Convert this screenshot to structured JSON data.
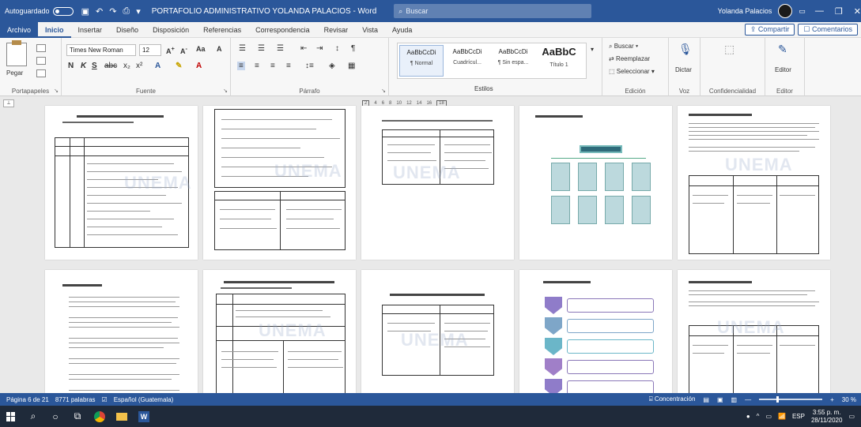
{
  "titlebar": {
    "autosave_label": "Autoguardado",
    "document_title": "PORTAFOLIO ADMINISTRATIVO YOLANDA PALACIOS - Word",
    "search_placeholder": "Buscar",
    "user_name": "Yolanda Palacios"
  },
  "tabs": [
    {
      "label": "Archivo"
    },
    {
      "label": "Inicio"
    },
    {
      "label": "Insertar"
    },
    {
      "label": "Diseño"
    },
    {
      "label": "Disposición"
    },
    {
      "label": "Referencias"
    },
    {
      "label": "Correspondencia"
    },
    {
      "label": "Revisar"
    },
    {
      "label": "Vista"
    },
    {
      "label": "Ayuda"
    }
  ],
  "share_label": "Compartir",
  "comments_label": "Comentarios",
  "ribbon": {
    "paste_label": "Pegar",
    "clipboard_label": "Portapapeles",
    "font_name": "Times New Roman",
    "font_size": "12",
    "font_group_label": "Fuente",
    "paragraph_label": "Párrafo",
    "styles": [
      {
        "sample": "AaBbCcDi",
        "name": "¶ Normal"
      },
      {
        "sample": "AaBbCcDi",
        "name": "Cuadrícul..."
      },
      {
        "sample": "AaBbCcDi",
        "name": "¶ Sin espa..."
      },
      {
        "sample": "AaBbC",
        "name": "Título 1"
      }
    ],
    "styles_label": "Estilos",
    "find_label": "Buscar",
    "replace_label": "Reemplazar",
    "select_label": "Seleccionar",
    "editing_label": "Edición",
    "dictate_label": "Dictar",
    "voice_label": "Voz",
    "sensitivity_label": "Confidencialidad",
    "editor_label": "Editor"
  },
  "pager": [
    "2",
    "4",
    "6",
    "8",
    "10",
    "12",
    "14",
    "16",
    "18"
  ],
  "watermark": "UNEMA",
  "status": {
    "page": "Página 6 de 21",
    "words": "8771 palabras",
    "language": "Español (Guatemala)",
    "focus": "Concentración",
    "zoom": "30 %"
  },
  "taskbar": {
    "time": "3:55 p. m.",
    "date": "28/11/2020",
    "lang": "ESP"
  }
}
